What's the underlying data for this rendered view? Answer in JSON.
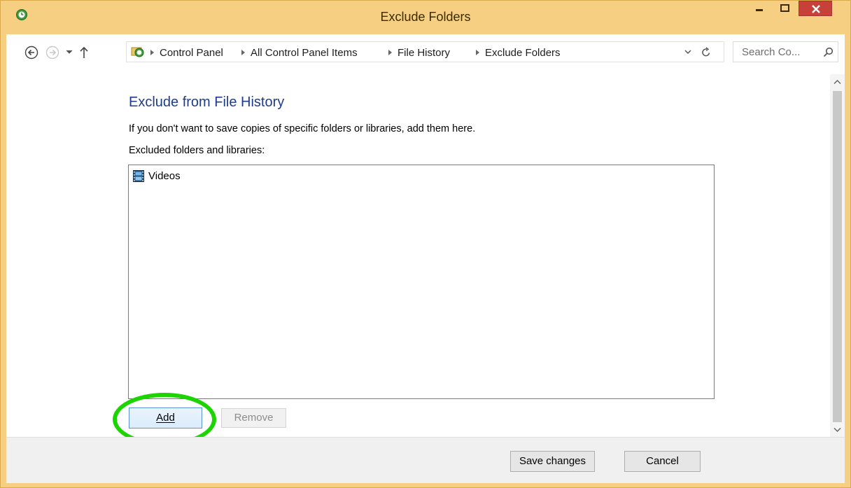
{
  "window": {
    "title": "Exclude Folders",
    "accent": "#f6cf82",
    "close_color": "#c7403a",
    "icons": [
      "file-history-icon",
      "minimize-icon",
      "maximize-icon",
      "close-icon"
    ]
  },
  "addressbar": {
    "breadcrumbs": [
      "Control Panel",
      "All Control Panel Items",
      "File History",
      "Exclude Folders"
    ],
    "search_placeholder": "Search Co...",
    "icons": [
      "back-arrow-icon",
      "forward-arrow-icon",
      "recent-locations-chevron-icon",
      "up-arrow-icon",
      "file-history-icon",
      "dropdown-chevron-icon",
      "refresh-icon",
      "search-icon"
    ]
  },
  "main": {
    "heading": "Exclude from File History",
    "description": "If you don't want to save copies of specific folders or libraries, add them here.",
    "list_label": "Excluded folders and libraries:",
    "excluded_items": [
      {
        "label": "Videos",
        "icon": "videos-library-icon"
      }
    ],
    "add_label": "Add",
    "remove_label": "Remove",
    "highlight_color": "#1bd400"
  },
  "footer": {
    "save_label": "Save changes",
    "cancel_label": "Cancel"
  }
}
